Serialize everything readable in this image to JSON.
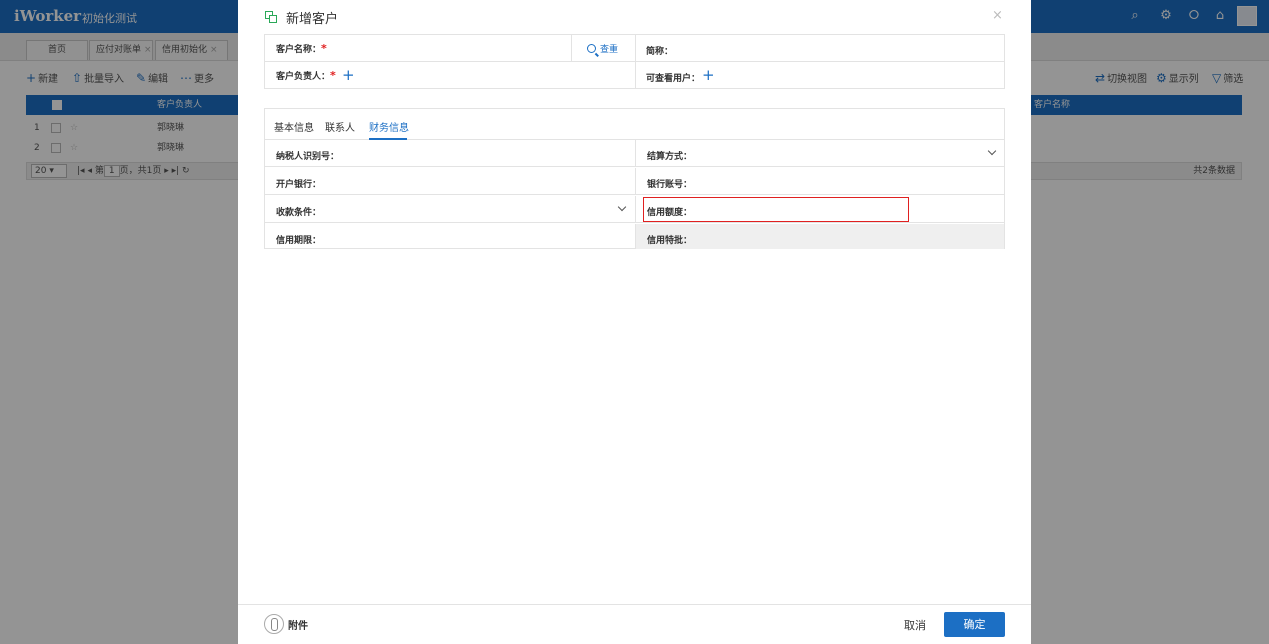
{
  "app": {
    "logo": "iWorker",
    "title": "初始化测试"
  },
  "header_icons": [
    "search-icon",
    "gear-icon",
    "chat-icon",
    "bell-icon"
  ],
  "tabs": [
    {
      "label": "首页"
    },
    {
      "label": "应付对账单"
    },
    {
      "label": "信用初始化"
    }
  ],
  "toolbar": {
    "new": "新建",
    "batch_import": "批量导入",
    "edit": "编辑",
    "more": "更多",
    "switch_view": "切换视图",
    "show_columns": "显示列",
    "filter": "筛选"
  },
  "grid": {
    "col_owner": "客户负责人",
    "col_name": "客户名称",
    "rows": [
      {
        "num": "1",
        "owner": "郭晓琳"
      },
      {
        "num": "2",
        "owner": "郭晓琳"
      }
    ],
    "pager": {
      "size": "20",
      "page_prefix": "第",
      "page": "1",
      "page_suffix": "页，共1页",
      "total": "共2条数据"
    }
  },
  "modal": {
    "title": "新增客户",
    "close": "×",
    "customer_name_label": "客户名称：",
    "query_label": "查重",
    "short_name_label": "简称：",
    "owner_label": "客户负责人：",
    "viewer_label": "可查看用户：",
    "required_mark": "*",
    "tabs": [
      "基本信息",
      "联系人",
      "财务信息"
    ],
    "active_tab": "财务信息",
    "fields": {
      "tax_id": "纳税人识别号：",
      "settlement": "结算方式：",
      "bank": "开户银行：",
      "bank_account": "银行账号：",
      "payment_terms": "收款条件：",
      "credit_limit": "信用额度：",
      "credit_period": "信用期限：",
      "credit_special": "信用特批："
    },
    "footer": {
      "attachment": "附件",
      "cancel": "取消",
      "confirm": "确定"
    }
  },
  "colors": {
    "primary": "#1c6fc4",
    "required": "#e02020",
    "highlight": "#e02020",
    "title_icon": "#2aa858"
  }
}
